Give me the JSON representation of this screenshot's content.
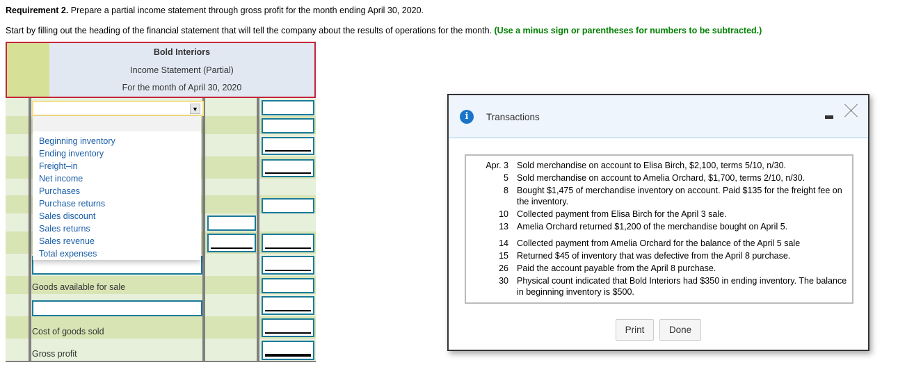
{
  "requirement": {
    "bold": "Requirement 2.",
    "text": " Prepare a partial income statement through gross profit for the month ending April 30, 2020."
  },
  "instruction": {
    "text": "Start by filling out the heading of the financial statement that will tell the company about the results of operations for the month. ",
    "hint": "(Use a minus sign or parentheses for numbers to be subtracted.)",
    "hint_color": "#008000"
  },
  "statement": {
    "company": "Bold Interiors",
    "title": "Income Statement (Partial)",
    "period": "For the month of April 30, 2020",
    "select": {
      "value": "",
      "arrow": "▼"
    },
    "dropdown_options": [
      "",
      "Beginning inventory",
      "Ending inventory",
      "Freight–in",
      "Net income",
      "Purchases",
      "Purchase returns",
      "Sales discount",
      "Sales returns",
      "Sales revenue",
      "Total expenses"
    ],
    "labels": {
      "goods_available": "Goods available for sale",
      "cogs": "Cost of goods sold",
      "gross_profit": "Gross profit"
    }
  },
  "dialog": {
    "title": "Transactions",
    "info_icon": "i",
    "transactions": [
      {
        "date": "Apr. 3",
        "text": "Sold merchandise on account to Elisa Birch, $2,100, terms 5/10, n/30."
      },
      {
        "date": "5",
        "text": "Sold merchandise on account to Amelia Orchard, $1,700, terms 2/10, n/30."
      },
      {
        "date": "8",
        "text": "Bought $1,475 of merchandise inventory on account. Paid $135 for the freight fee on the inventory."
      },
      {
        "date": "10",
        "text": "Collected payment from Elisa Birch for the April 3 sale."
      },
      {
        "date": "13",
        "text": "Amelia Orchard returned $1,200 of the merchandise bought on April 5."
      },
      {
        "date": "14",
        "text": "Collected payment from Amelia Orchard for the balance of the April 5 sale"
      },
      {
        "date": "15",
        "text": "Returned $45 of inventory that was defective from the April 8 purchase."
      },
      {
        "date": "26",
        "text": "Paid the account payable from the April 8 purchase."
      },
      {
        "date": "30",
        "text": "Physical count indicated that Bold Interiors had $350 in ending inventory. The balance in beginning inventory is $500."
      }
    ],
    "print_label": "Print",
    "done_label": "Done"
  }
}
